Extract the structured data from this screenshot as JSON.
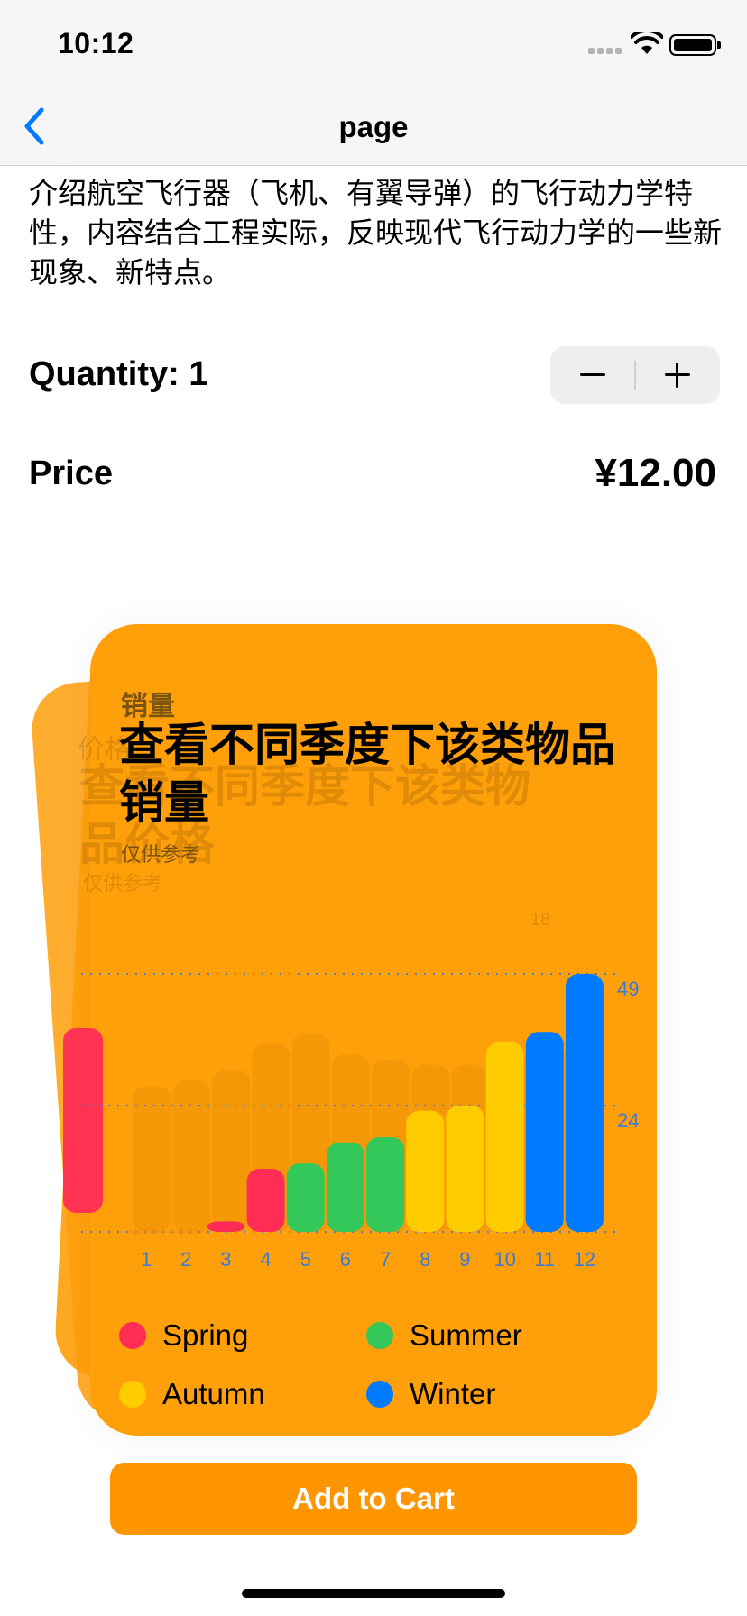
{
  "status_bar": {
    "time": "10:12"
  },
  "nav": {
    "title": "page"
  },
  "description": "和使用部分的工程技术人员也有参考价值。该书系统地介绍航空飞行器（飞机、有翼导弹）的飞行动力学特性，内容结合工程实际，反映现代飞行动力学的一些新现象、新特点。",
  "quantity": {
    "label": "Quantity:  1"
  },
  "price": {
    "label": "Price",
    "value": "¥12.00"
  },
  "card": {
    "kicker": "销量",
    "title": "查看不同季度下该类物品销量",
    "subtitle": "仅供参考",
    "ghost_kicker": "价格",
    "ghost_title": "查看不同季度下该类物品价格",
    "ghost_subtitle": "仅供参考"
  },
  "chart_data": {
    "type": "bar",
    "categories": [
      "1",
      "2",
      "3",
      "4",
      "5",
      "6",
      "7",
      "8",
      "9",
      "10",
      "11",
      "12"
    ],
    "series": [
      {
        "name": "Spring",
        "color": "#ff2d55",
        "months": [
          1,
          2,
          3
        ],
        "values": [
          0,
          0,
          2
        ]
      },
      {
        "name": "Spring",
        "color": "#ff2d55",
        "months": [
          4
        ],
        "values": [
          12
        ]
      },
      {
        "name": "Summer",
        "color": "#34c759",
        "months": [
          5,
          6,
          7
        ],
        "values": [
          13,
          17,
          18
        ]
      },
      {
        "name": "Autumn",
        "color": "#ffcc00",
        "months": [
          8,
          9,
          10
        ],
        "values": [
          23,
          24,
          36
        ]
      },
      {
        "name": "Winter",
        "color": "#007aff",
        "months": [
          11,
          12
        ],
        "values": [
          38,
          49
        ]
      }
    ],
    "bars": [
      {
        "month": "1",
        "value": 0,
        "season": "Spring"
      },
      {
        "month": "2",
        "value": 0,
        "season": "Spring"
      },
      {
        "month": "3",
        "value": 2,
        "season": "Spring"
      },
      {
        "month": "4",
        "value": 12,
        "season": "Spring"
      },
      {
        "month": "5",
        "value": 13,
        "season": "Summer"
      },
      {
        "month": "6",
        "value": 17,
        "season": "Summer"
      },
      {
        "month": "7",
        "value": 18,
        "season": "Summer"
      },
      {
        "month": "8",
        "value": 23,
        "season": "Autumn"
      },
      {
        "month": "9",
        "value": 24,
        "season": "Autumn"
      },
      {
        "month": "10",
        "value": 36,
        "season": "Autumn"
      },
      {
        "month": "11",
        "value": 38,
        "season": "Winter"
      },
      {
        "month": "12",
        "value": 49,
        "season": "Winter"
      }
    ],
    "y_ticks": [
      "49",
      "24"
    ],
    "ylim": [
      0,
      49
    ],
    "grid": true,
    "legend": [
      {
        "label": "Spring",
        "color": "#ff2d55"
      },
      {
        "label": "Summer",
        "color": "#34c759"
      },
      {
        "label": "Autumn",
        "color": "#ffcc00"
      },
      {
        "label": "Winter",
        "color": "#007aff"
      }
    ],
    "legend_placement": "bottom",
    "ghost_ticks": [
      "18"
    ]
  },
  "cart_button": {
    "label": "Add to Cart"
  },
  "colors": {
    "accent": "#ff9500",
    "card": "#ff9f0a",
    "link": "#007aff"
  }
}
